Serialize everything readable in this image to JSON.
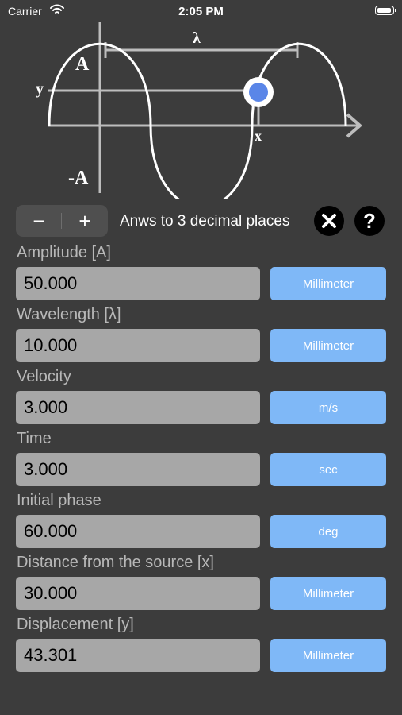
{
  "status_bar": {
    "carrier": "Carrier",
    "time": "2:05 PM"
  },
  "diagram": {
    "label_wavelength": "λ",
    "label_amplitude_pos": "A",
    "label_amplitude_neg": "-A",
    "label_y": "y",
    "label_x": "x",
    "colors": {
      "curve": "#ffffff",
      "axes": "#bdbdbd",
      "point": "#5a86e8"
    }
  },
  "controls": {
    "decrement_label": "−",
    "increment_label": "+",
    "decimals_text": "Anws to 3 decimal places",
    "clear_icon": "close-icon",
    "help_label": "?"
  },
  "fields": [
    {
      "label": "Amplitude [A]",
      "value": "50.000",
      "unit": "Millimeter"
    },
    {
      "label": "Wavelength [λ]",
      "value": "10.000",
      "unit": "Millimeter"
    },
    {
      "label": "Velocity",
      "value": "3.000",
      "unit": "m/s"
    },
    {
      "label": "Time",
      "value": "3.000",
      "unit": "sec"
    },
    {
      "label": "Initial phase",
      "value": "60.000",
      "unit": "deg"
    },
    {
      "label": "Distance from the source [x]",
      "value": "30.000",
      "unit": "Millimeter"
    },
    {
      "label": "Displacement [y]",
      "value": "43.301",
      "unit": "Millimeter"
    }
  ],
  "colors": {
    "background": "#3c3c3c",
    "field": "#a7a7a7",
    "unit_button": "#7fb8f7"
  }
}
